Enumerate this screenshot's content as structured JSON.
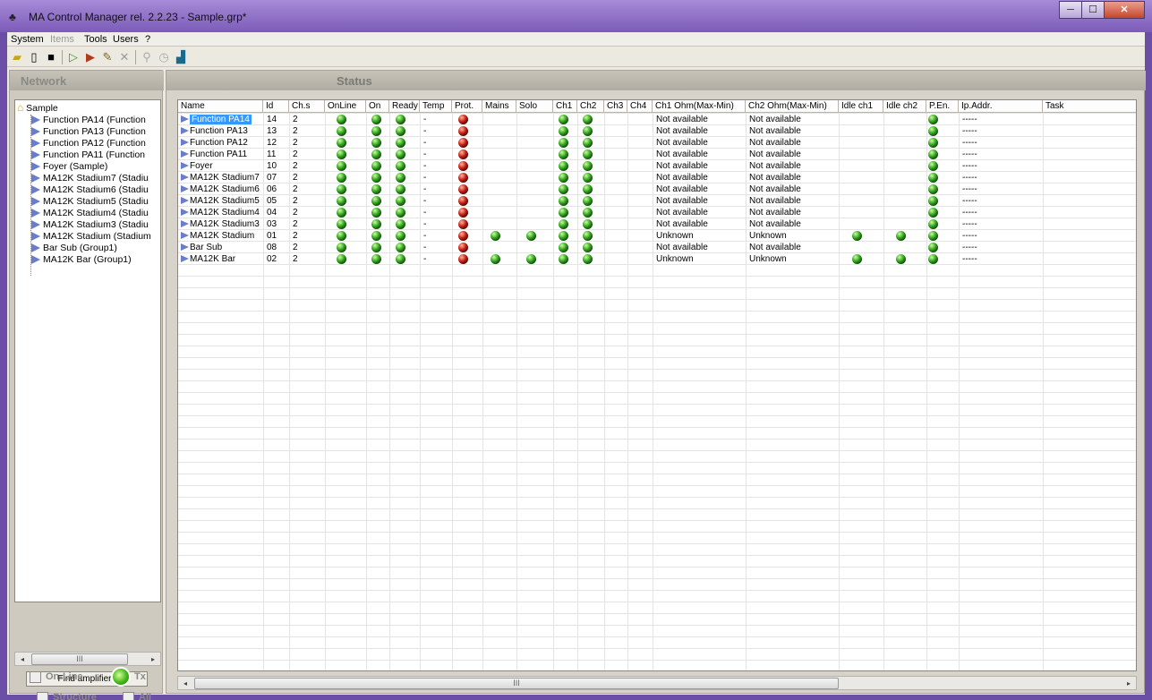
{
  "window": {
    "title": "MA Control Manager rel. 2.2.23 - Sample.grp*",
    "min": "─",
    "max": "☐",
    "close": "✕"
  },
  "menu": [
    {
      "label": "System",
      "disabled": false
    },
    {
      "label": "Items",
      "disabled": true
    },
    {
      "label": "Tools",
      "disabled": false
    },
    {
      "label": "Users",
      "disabled": false
    },
    {
      "label": "?",
      "disabled": false
    }
  ],
  "toolbar": {
    "icons": [
      "open-folder-icon",
      "new-file-icon",
      "save-icon",
      "play-icon",
      "amplifier-icon",
      "wrench-icon",
      "delete-icon",
      "key-icon",
      "clock-icon",
      "graph-icon"
    ]
  },
  "network": {
    "title": "Network",
    "root": "Sample",
    "items": [
      "Function PA14 (Function",
      "Function PA13 (Function",
      "Function PA12 (Function",
      "Function PA11 (Function",
      "Foyer (Sample)",
      "MA12K Stadium7 (Stadiu",
      "MA12K Stadium6 (Stadiu",
      "MA12K Stadium5 (Stadiu",
      "MA12K Stadium4 (Stadiu",
      "MA12K Stadium3 (Stadiu",
      "MA12K Stadium (Stadium",
      "Bar Sub (Group1)",
      "MA12K Bar (Group1)"
    ],
    "scroll_thumb": "III",
    "find_button": "Find amplifiers",
    "structure": "Structure",
    "all": "All",
    "online": "On-Line",
    "tx": "Tx"
  },
  "status": {
    "title": "Status",
    "columns": [
      "Name",
      "Id",
      "Ch.s",
      "OnLine",
      "On",
      "Ready",
      "Temp",
      "Prot.",
      "Mains",
      "Solo",
      "Ch1",
      "Ch2",
      "Ch3",
      "Ch4",
      "Ch1 Ohm(Max-Min)",
      "Ch2 Ohm(Max-Min)",
      "Idle ch1",
      "Idle ch2",
      "P.En.",
      "Ip.Addr.",
      "Task"
    ],
    "rows": [
      {
        "name": "Function PA14",
        "id": "14",
        "chs": "2",
        "temp": "-",
        "mains": "",
        "solo": "",
        "ch1ohm": "Not available",
        "ch2ohm": "Not available",
        "idle1": "",
        "idle2": "",
        "ip": "-----",
        "selected": true
      },
      {
        "name": "Function PA13",
        "id": "13",
        "chs": "2",
        "temp": "-",
        "mains": "",
        "solo": "",
        "ch1ohm": "Not available",
        "ch2ohm": "Not available",
        "idle1": "",
        "idle2": "",
        "ip": "-----"
      },
      {
        "name": "Function PA12",
        "id": "12",
        "chs": "2",
        "temp": "-",
        "mains": "",
        "solo": "",
        "ch1ohm": "Not available",
        "ch2ohm": "Not available",
        "idle1": "",
        "idle2": "",
        "ip": "-----"
      },
      {
        "name": "Function PA11",
        "id": "11",
        "chs": "2",
        "temp": "-",
        "mains": "",
        "solo": "",
        "ch1ohm": "Not available",
        "ch2ohm": "Not available",
        "idle1": "",
        "idle2": "",
        "ip": "-----"
      },
      {
        "name": "Foyer",
        "id": "10",
        "chs": "2",
        "temp": "-",
        "mains": "",
        "solo": "",
        "ch1ohm": "Not available",
        "ch2ohm": "Not available",
        "idle1": "",
        "idle2": "",
        "ip": "-----"
      },
      {
        "name": "MA12K Stadium7",
        "id": "07",
        "chs": "2",
        "temp": "-",
        "mains": "",
        "solo": "",
        "ch1ohm": "Not available",
        "ch2ohm": "Not available",
        "idle1": "",
        "idle2": "",
        "ip": "-----"
      },
      {
        "name": "MA12K Stadium6",
        "id": "06",
        "chs": "2",
        "temp": "-",
        "mains": "",
        "solo": "",
        "ch1ohm": "Not available",
        "ch2ohm": "Not available",
        "idle1": "",
        "idle2": "",
        "ip": "-----"
      },
      {
        "name": "MA12K Stadium5",
        "id": "05",
        "chs": "2",
        "temp": "-",
        "mains": "",
        "solo": "",
        "ch1ohm": "Not available",
        "ch2ohm": "Not available",
        "idle1": "",
        "idle2": "",
        "ip": "-----"
      },
      {
        "name": "MA12K Stadium4",
        "id": "04",
        "chs": "2",
        "temp": "-",
        "mains": "",
        "solo": "",
        "ch1ohm": "Not available",
        "ch2ohm": "Not available",
        "idle1": "",
        "idle2": "",
        "ip": "-----"
      },
      {
        "name": "MA12K Stadium3",
        "id": "03",
        "chs": "2",
        "temp": "-",
        "mains": "",
        "solo": "",
        "ch1ohm": "Not available",
        "ch2ohm": "Not available",
        "idle1": "",
        "idle2": "",
        "ip": "-----"
      },
      {
        "name": "MA12K Stadium",
        "id": "01",
        "chs": "2",
        "temp": "-",
        "mains": "g",
        "solo": "g",
        "ch1ohm": "Unknown",
        "ch2ohm": "Unknown",
        "idle1": "g",
        "idle2": "g",
        "ip": "-----"
      },
      {
        "name": "Bar Sub",
        "id": "08",
        "chs": "2",
        "temp": "-",
        "mains": "",
        "solo": "",
        "ch1ohm": "Not available",
        "ch2ohm": "Not available",
        "idle1": "",
        "idle2": "",
        "ip": "-----"
      },
      {
        "name": "MA12K Bar",
        "id": "02",
        "chs": "2",
        "temp": "-",
        "mains": "g",
        "solo": "g",
        "ch1ohm": "Unknown",
        "ch2ohm": "Unknown",
        "idle1": "g",
        "idle2": "g",
        "ip": "-----"
      }
    ],
    "scroll_thumb": "III"
  },
  "colors": {
    "led_green": "#2fa01b",
    "led_red": "#c21d12",
    "selection": "#3399ff",
    "title_bar": "#7c5cb8"
  }
}
